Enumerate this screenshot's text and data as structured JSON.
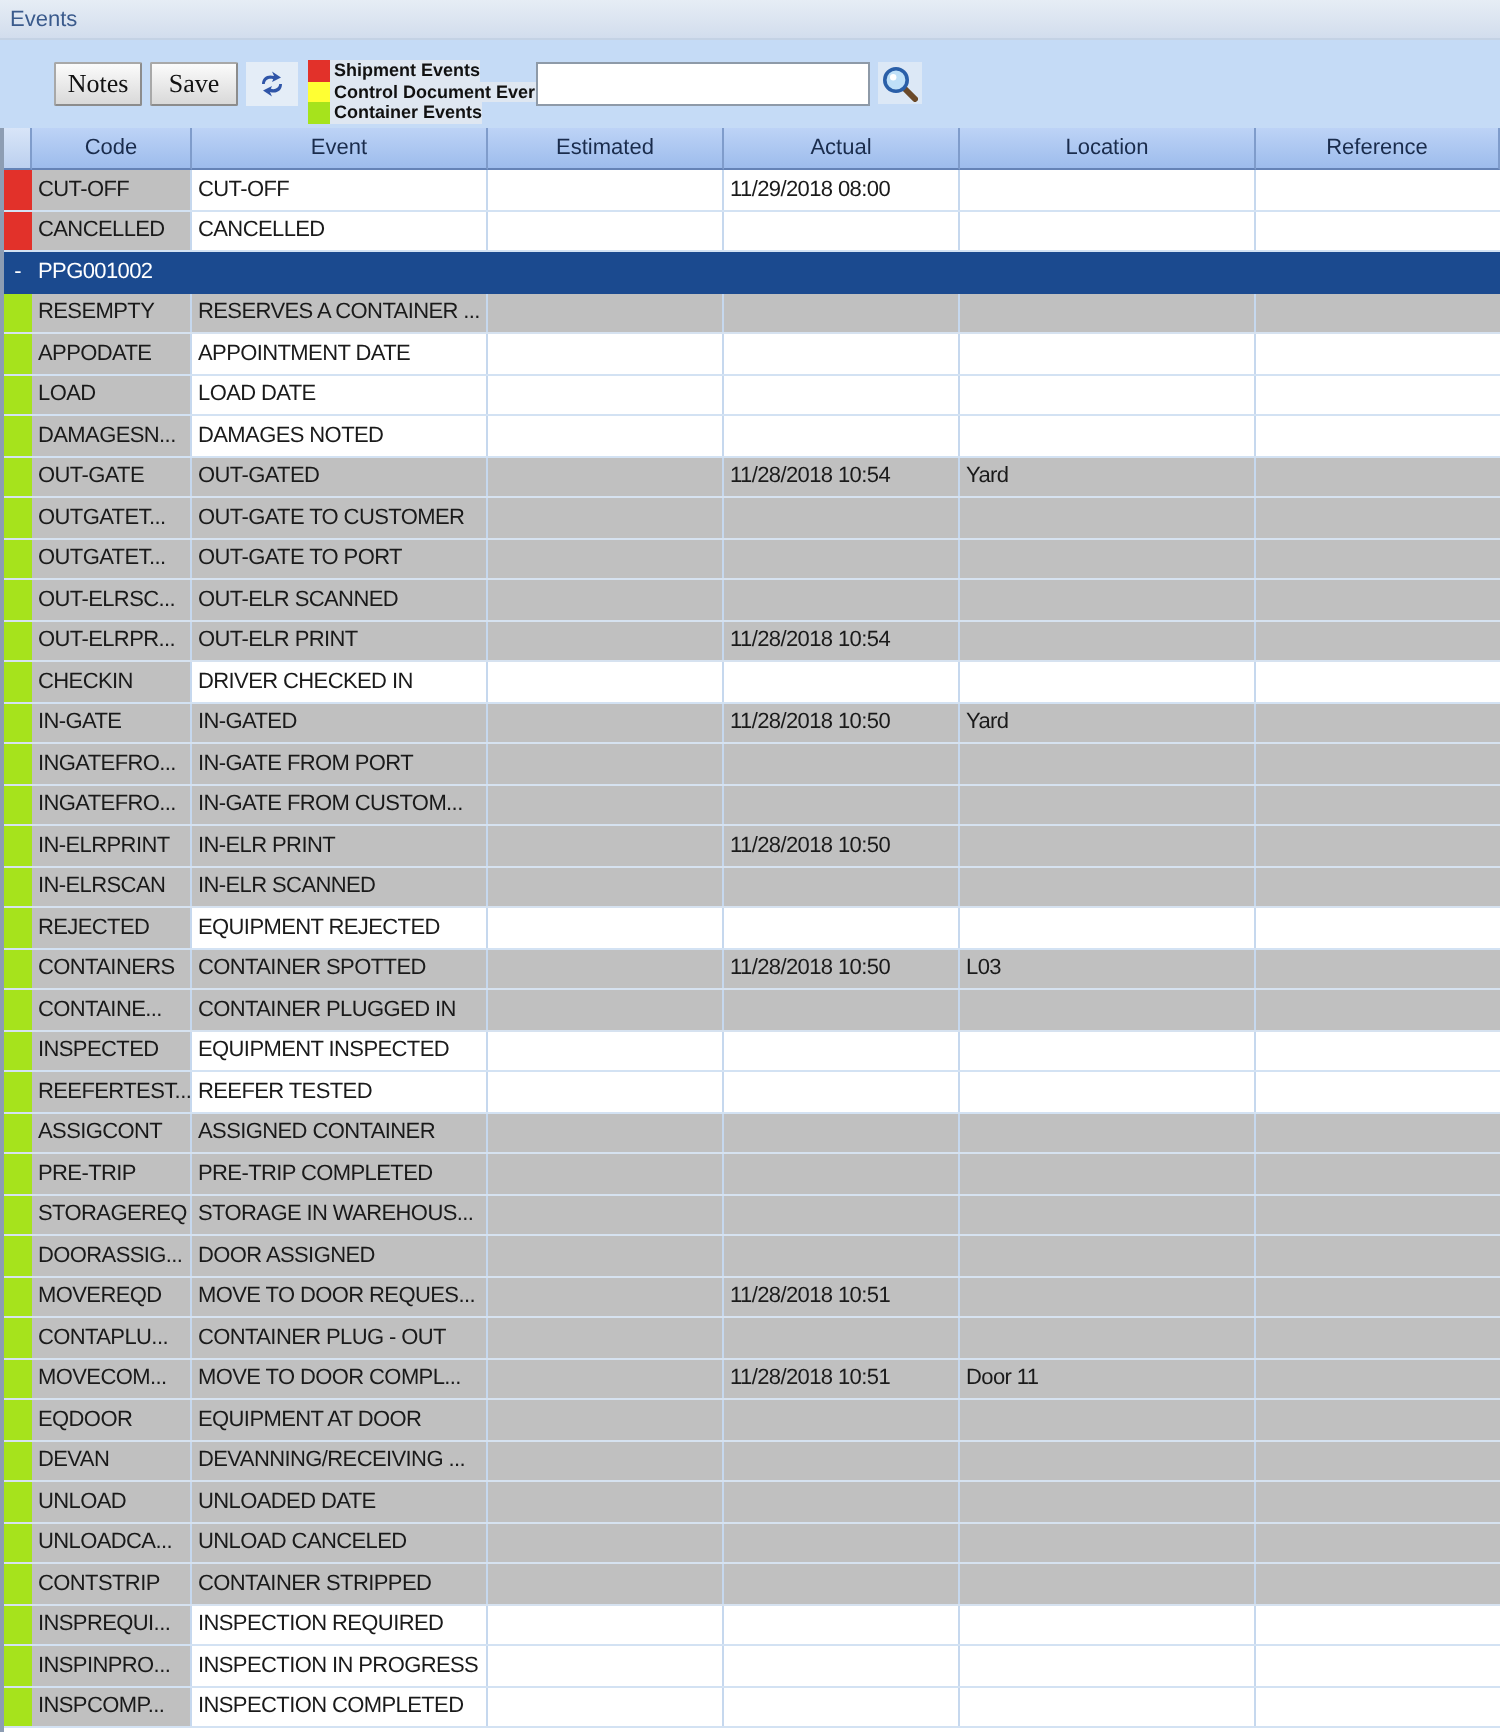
{
  "window": {
    "title": "Events"
  },
  "toolbar": {
    "buttons": [
      {
        "label": "Notes"
      },
      {
        "label": "Save"
      }
    ]
  },
  "legend": [
    {
      "label": "Shipment Events",
      "color": "#e2312a"
    },
    {
      "label": "Control Document Ever",
      "color": "#ffff33"
    },
    {
      "label": "Container Events",
      "color": "#a6e31c"
    }
  ],
  "table": {
    "columns": [
      "Code",
      "Event",
      "Estimated",
      "Actual",
      "Location",
      "Reference"
    ],
    "rows": [
      {
        "kind": "event",
        "color": "#e2312a",
        "shaded": false,
        "selected": false,
        "code": "CUT-OFF",
        "event": "CUT-OFF",
        "actual": "11/29/2018 08:00"
      },
      {
        "kind": "event",
        "color": "#e2312a",
        "shaded": false,
        "selected": false,
        "code": "CANCELLED",
        "event": "CANCELLED"
      },
      {
        "kind": "group",
        "toggle": "-",
        "selected": true,
        "code": "PPG001002"
      },
      {
        "kind": "event",
        "color": "#a6e31c",
        "shaded": true,
        "selected": false,
        "code": "RESEMPTY",
        "event": "RESERVES A CONTAINER ..."
      },
      {
        "kind": "event",
        "color": "#a6e31c",
        "shaded": false,
        "selected": false,
        "code": "APPODATE",
        "event": "APPOINTMENT DATE"
      },
      {
        "kind": "event",
        "color": "#a6e31c",
        "shaded": false,
        "selected": false,
        "code": "LOAD",
        "event": "LOAD DATE"
      },
      {
        "kind": "event",
        "color": "#a6e31c",
        "shaded": false,
        "selected": false,
        "code": "DAMAGESN...",
        "event": "DAMAGES NOTED"
      },
      {
        "kind": "event",
        "color": "#a6e31c",
        "shaded": true,
        "selected": false,
        "code": "OUT-GATE",
        "event": "OUT-GATED",
        "actual": "11/28/2018 10:54",
        "location": "Yard"
      },
      {
        "kind": "event",
        "color": "#a6e31c",
        "shaded": true,
        "selected": false,
        "code": "OUTGATET...",
        "event": "OUT-GATE TO CUSTOMER"
      },
      {
        "kind": "event",
        "color": "#a6e31c",
        "shaded": true,
        "selected": false,
        "code": "OUTGATET...",
        "event": "OUT-GATE TO PORT"
      },
      {
        "kind": "event",
        "color": "#a6e31c",
        "shaded": true,
        "selected": false,
        "code": "OUT-ELRSC...",
        "event": "OUT-ELR SCANNED"
      },
      {
        "kind": "event",
        "color": "#a6e31c",
        "shaded": true,
        "selected": false,
        "code": "OUT-ELRPR...",
        "event": "OUT-ELR PRINT",
        "actual": "11/28/2018 10:54"
      },
      {
        "kind": "event",
        "color": "#a6e31c",
        "shaded": false,
        "selected": false,
        "code": "CHECKIN",
        "event": "DRIVER CHECKED IN"
      },
      {
        "kind": "event",
        "color": "#a6e31c",
        "shaded": true,
        "selected": false,
        "code": "IN-GATE",
        "event": "IN-GATED",
        "actual": "11/28/2018 10:50",
        "location": "Yard"
      },
      {
        "kind": "event",
        "color": "#a6e31c",
        "shaded": true,
        "selected": false,
        "code": "INGATEFRO...",
        "event": "IN-GATE FROM PORT"
      },
      {
        "kind": "event",
        "color": "#a6e31c",
        "shaded": true,
        "selected": false,
        "code": "INGATEFRO...",
        "event": "IN-GATE FROM CUSTOM..."
      },
      {
        "kind": "event",
        "color": "#a6e31c",
        "shaded": true,
        "selected": false,
        "code": "IN-ELRPRINT",
        "event": "IN-ELR PRINT",
        "actual": "11/28/2018 10:50"
      },
      {
        "kind": "event",
        "color": "#a6e31c",
        "shaded": true,
        "selected": false,
        "code": "IN-ELRSCAN",
        "event": "IN-ELR SCANNED"
      },
      {
        "kind": "event",
        "color": "#a6e31c",
        "shaded": false,
        "selected": false,
        "code": "REJECTED",
        "event": "EQUIPMENT REJECTED"
      },
      {
        "kind": "event",
        "color": "#a6e31c",
        "shaded": true,
        "selected": false,
        "code": "CONTAINERS",
        "event": "CONTAINER SPOTTED",
        "actual": "11/28/2018 10:50",
        "location": "L03"
      },
      {
        "kind": "event",
        "color": "#a6e31c",
        "shaded": true,
        "selected": false,
        "code": "CONTAINE...",
        "event": "CONTAINER PLUGGED IN"
      },
      {
        "kind": "event",
        "color": "#a6e31c",
        "shaded": false,
        "selected": false,
        "code": "INSPECTED",
        "event": "EQUIPMENT INSPECTED"
      },
      {
        "kind": "event",
        "color": "#a6e31c",
        "shaded": false,
        "selected": false,
        "code": "REEFERTEST...",
        "event": "REEFER TESTED"
      },
      {
        "kind": "event",
        "color": "#a6e31c",
        "shaded": true,
        "selected": false,
        "code": "ASSIGCONT",
        "event": "ASSIGNED CONTAINER"
      },
      {
        "kind": "event",
        "color": "#a6e31c",
        "shaded": true,
        "selected": false,
        "code": "PRE-TRIP",
        "event": "PRE-TRIP COMPLETED"
      },
      {
        "kind": "event",
        "color": "#a6e31c",
        "shaded": true,
        "selected": false,
        "code": "STORAGEREQ",
        "event": "STORAGE IN WAREHOUS..."
      },
      {
        "kind": "event",
        "color": "#a6e31c",
        "shaded": true,
        "selected": false,
        "code": "DOORASSIG...",
        "event": "DOOR ASSIGNED"
      },
      {
        "kind": "event",
        "color": "#a6e31c",
        "shaded": true,
        "selected": false,
        "code": "MOVEREQD",
        "event": "MOVE TO DOOR REQUES...",
        "actual": "11/28/2018 10:51"
      },
      {
        "kind": "event",
        "color": "#a6e31c",
        "shaded": true,
        "selected": false,
        "code": "CONTAPLU...",
        "event": "CONTAINER PLUG - OUT"
      },
      {
        "kind": "event",
        "color": "#a6e31c",
        "shaded": true,
        "selected": false,
        "code": "MOVECOM...",
        "event": "MOVE TO DOOR COMPL...",
        "actual": "11/28/2018 10:51",
        "location": "Door 11"
      },
      {
        "kind": "event",
        "color": "#a6e31c",
        "shaded": true,
        "selected": false,
        "code": "EQDOOR",
        "event": "EQUIPMENT AT DOOR"
      },
      {
        "kind": "event",
        "color": "#a6e31c",
        "shaded": true,
        "selected": false,
        "code": "DEVAN",
        "event": "DEVANNING/RECEIVING ..."
      },
      {
        "kind": "event",
        "color": "#a6e31c",
        "shaded": true,
        "selected": false,
        "code": "UNLOAD",
        "event": "UNLOADED DATE"
      },
      {
        "kind": "event",
        "color": "#a6e31c",
        "shaded": true,
        "selected": false,
        "code": "UNLOADCA...",
        "event": "UNLOAD CANCELED"
      },
      {
        "kind": "event",
        "color": "#a6e31c",
        "shaded": true,
        "selected": false,
        "code": "CONTSTRIP",
        "event": "CONTAINER STRIPPED"
      },
      {
        "kind": "event",
        "color": "#a6e31c",
        "shaded": false,
        "selected": false,
        "code": "INSPREQUI...",
        "event": "INSPECTION REQUIRED"
      },
      {
        "kind": "event",
        "color": "#a6e31c",
        "shaded": false,
        "selected": false,
        "code": "INSPINPRO...",
        "event": "INSPECTION IN PROGRESS"
      },
      {
        "kind": "event",
        "color": "#a6e31c",
        "shaded": false,
        "selected": false,
        "code": "INSPCOMP...",
        "event": "INSPECTION COMPLETED"
      }
    ]
  }
}
